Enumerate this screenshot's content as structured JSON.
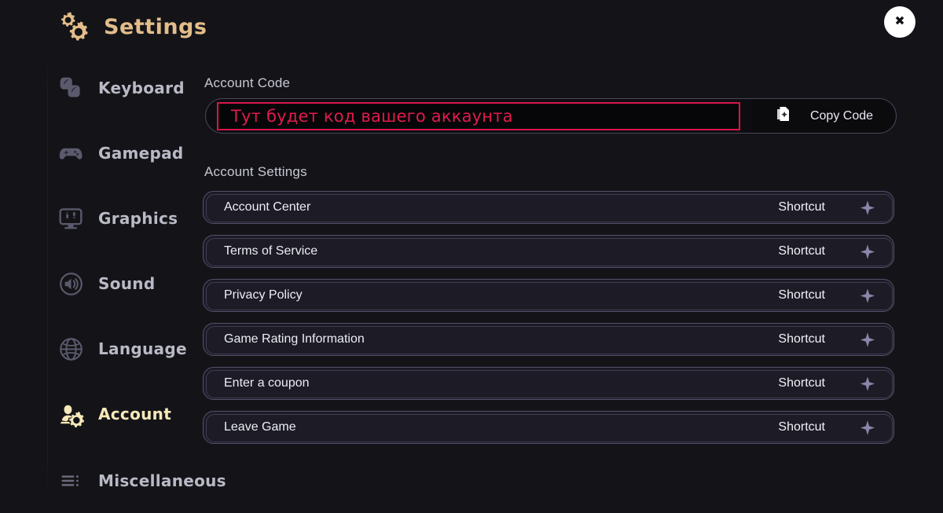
{
  "header": {
    "title": "Settings",
    "title_icon": "gears-icon",
    "close_icon": "close-x-icon",
    "accent_color": "#e3bd8a"
  },
  "sidebar": {
    "items": [
      {
        "label": "Keyboard",
        "icon": "keyboard-keys-icon",
        "active": false
      },
      {
        "label": "Gamepad",
        "icon": "gamepad-icon",
        "active": false
      },
      {
        "label": "Graphics",
        "icon": "monitor-icon",
        "active": false
      },
      {
        "label": "Sound",
        "icon": "speaker-icon",
        "active": false
      },
      {
        "label": "Language",
        "icon": "globe-icon",
        "active": false
      },
      {
        "label": "Account",
        "icon": "account-gear-icon",
        "active": true
      },
      {
        "label": "Miscellaneous",
        "icon": "list-icon",
        "active": false
      }
    ],
    "active_color": "#f6e8b8",
    "inactive_color": "#b9bac6"
  },
  "main": {
    "account_code": {
      "section_label": "Account Code",
      "value": "Тут будет код вашего аккаунта",
      "value_color": "#e01b4c",
      "border_color": "#d5174a",
      "copy_button": {
        "label": "Copy Code",
        "icon": "copy-document-icon"
      }
    },
    "account_settings": {
      "section_label": "Account Settings",
      "action_label": "Shortcut",
      "row_icon": "sparkle-icon",
      "rows": [
        {
          "label": "Account Center",
          "action": "Shortcut"
        },
        {
          "label": "Terms of Service",
          "action": "Shortcut"
        },
        {
          "label": "Privacy Policy",
          "action": "Shortcut"
        },
        {
          "label": "Game Rating Information",
          "action": "Shortcut"
        },
        {
          "label": "Enter a coupon",
          "action": "Shortcut"
        },
        {
          "label": "Leave Game",
          "action": "Shortcut"
        }
      ]
    }
  }
}
